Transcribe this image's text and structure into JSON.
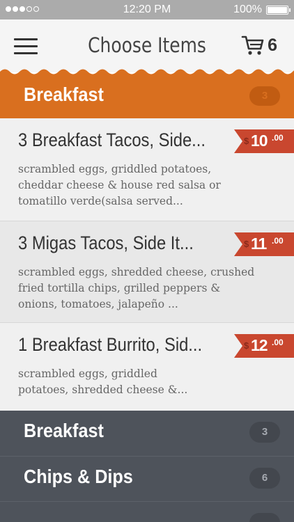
{
  "status_bar": {
    "time": "12:20 PM",
    "battery": "100%"
  },
  "header": {
    "title": "Choose Items",
    "cart_count": "6",
    "menu_icon": "hamburger-menu-icon",
    "cart_icon": "cart-icon"
  },
  "active_category": {
    "label": "Breakfast",
    "count": "3",
    "color": "#d96f1f"
  },
  "items": [
    {
      "name": "3 Breakfast Tacos, Side...",
      "description": "scrambled eggs, griddled potatoes, cheddar cheese & house red salsa or tomatillo verde(salsa served...",
      "currency": "$",
      "price": "10",
      "cents": ".00"
    },
    {
      "name": "3 Migas Tacos, Side It...",
      "description": "scrambled eggs, shredded cheese, crushed fried tortilla chips, grilled peppers & onions, tomatoes, jalapeño ...",
      "currency": "$",
      "price": "11",
      "cents": ".00"
    },
    {
      "name": "1 Breakfast Burrito, Sid...",
      "description": "scrambled eggs, griddled potatoes, shredded cheese &...",
      "currency": "$",
      "price": "12",
      "cents": ".00"
    }
  ],
  "categories": [
    {
      "label": "Breakfast",
      "count": "3"
    },
    {
      "label": "Chips & Dips",
      "count": "6"
    }
  ],
  "colors": {
    "price_tag": "#c9472f",
    "category_dark": "#4e535b"
  }
}
